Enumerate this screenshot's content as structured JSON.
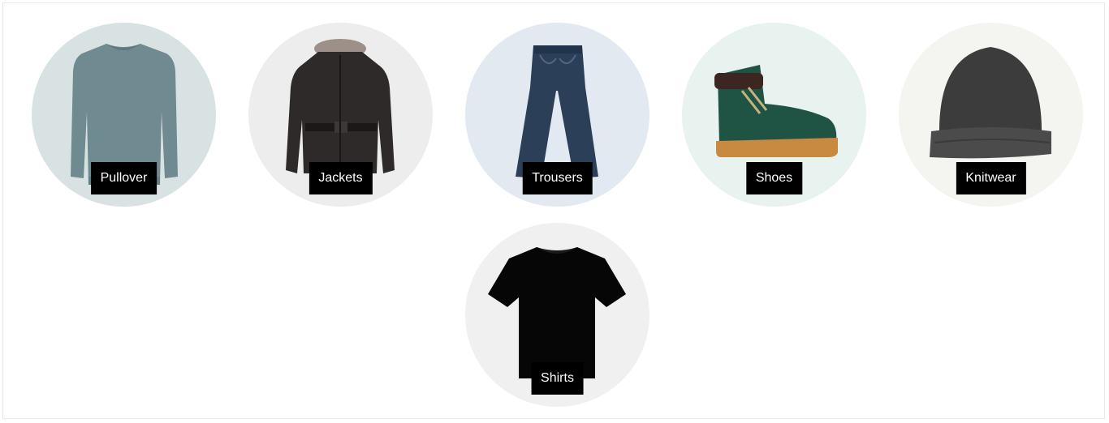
{
  "categories": [
    {
      "label": "Pullover",
      "icon": "pullover-image",
      "bg": "#d9e2e3"
    },
    {
      "label": "Jackets",
      "icon": "jacket-image",
      "bg": "#ededed"
    },
    {
      "label": "Trousers",
      "icon": "trousers-image",
      "bg": "#e3e9f1"
    },
    {
      "label": "Shoes",
      "icon": "boot-image",
      "bg": "#e8f2ef"
    },
    {
      "label": "Knitwear",
      "icon": "beanie-image",
      "bg": "#f4f4f0"
    },
    {
      "label": "Shirts",
      "icon": "tshirt-image",
      "bg": "#f0f0f0"
    }
  ],
  "colors": {
    "label_bg": "#000000",
    "label_text": "#ffffff"
  }
}
